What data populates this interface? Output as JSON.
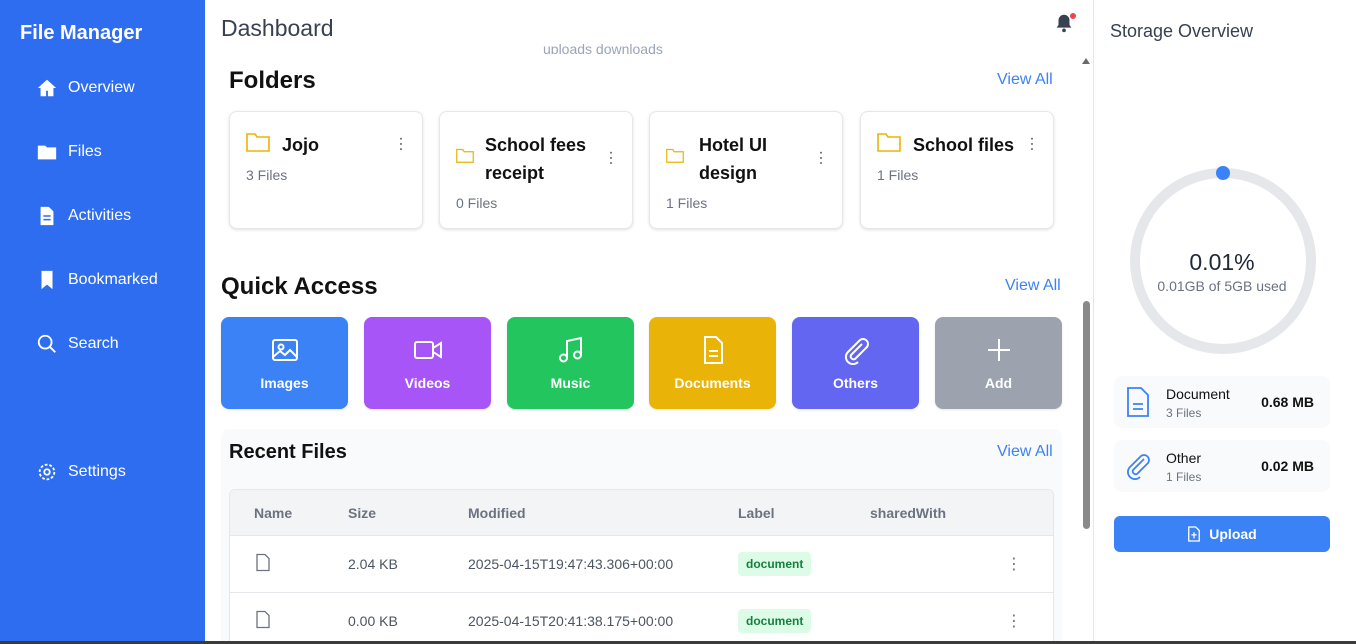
{
  "sidebar": {
    "brand": "File Manager",
    "items": [
      {
        "label": "Overview",
        "icon": "home-icon"
      },
      {
        "label": "Files",
        "icon": "folder-icon"
      },
      {
        "label": "Activities",
        "icon": "document-icon"
      },
      {
        "label": "Bookmarked",
        "icon": "bookmark-icon"
      },
      {
        "label": "Search",
        "icon": "search-icon"
      },
      {
        "label": "Settings",
        "icon": "gear-icon"
      }
    ]
  },
  "header": {
    "title": "Dashboard",
    "chart_legend_fragment": "uploads   downloads"
  },
  "folders": {
    "title": "Folders",
    "view_all": "View All",
    "items": [
      {
        "name": "Jojo",
        "count": "3 Files"
      },
      {
        "name": "School fees receipt",
        "count": "0 Files"
      },
      {
        "name": "Hotel UI design",
        "count": "1 Files"
      },
      {
        "name": "School files",
        "count": "1 Files"
      }
    ]
  },
  "quick_access": {
    "title": "Quick Access",
    "view_all": "View All",
    "items": [
      {
        "label": "Images",
        "color": "#3b82f6",
        "icon": "image-icon"
      },
      {
        "label": "Videos",
        "color": "#a855f7",
        "icon": "video-icon"
      },
      {
        "label": "Music",
        "color": "#22c55e",
        "icon": "music-icon"
      },
      {
        "label": "Documents",
        "color": "#eab308",
        "icon": "document-icon"
      },
      {
        "label": "Others",
        "color": "#6366f1",
        "icon": "paperclip-icon"
      },
      {
        "label": "Add",
        "color": "#9ca3af",
        "icon": "plus-icon"
      }
    ]
  },
  "recent_files": {
    "title": "Recent Files",
    "view_all": "View All",
    "columns": [
      "Name",
      "Size",
      "Modified",
      "Label",
      "sharedWith"
    ],
    "rows": [
      {
        "name": "",
        "size": "2.04 KB",
        "modified": "2025-04-15T19:47:43.306+00:00",
        "label": "document",
        "shared_with": ""
      },
      {
        "name": "",
        "size": "0.00 KB",
        "modified": "2025-04-15T20:41:38.175+00:00",
        "label": "document",
        "shared_with": ""
      }
    ]
  },
  "storage": {
    "title": "Storage Overview",
    "percent": "0.01%",
    "percent_value": 0.01,
    "used_text": "0.01GB of 5GB used",
    "categories": [
      {
        "name": "Document",
        "count": "3 Files",
        "size": "0.68 MB",
        "icon": "document-icon"
      },
      {
        "name": "Other",
        "count": "1 Files",
        "size": "0.02 MB",
        "icon": "paperclip-icon"
      }
    ],
    "upload_label": "Upload"
  },
  "colors": {
    "sidebar": "#2f6df0",
    "accent": "#3b82f6",
    "folder_icon": "#eab308",
    "badge_bg": "#dcfce7",
    "badge_text": "#15803d",
    "notification_dot": "#ef4444"
  }
}
